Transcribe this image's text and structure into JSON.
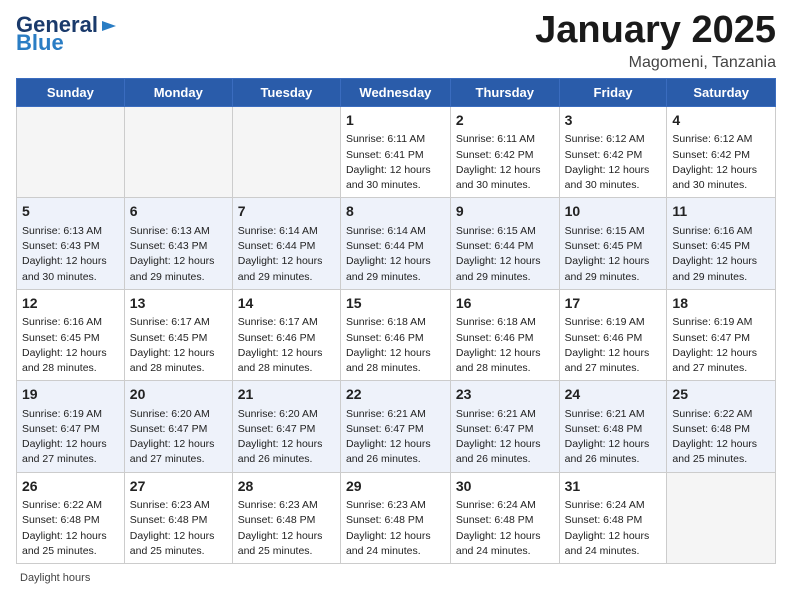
{
  "header": {
    "logo_line1": "General",
    "logo_line2": "Blue",
    "month_title": "January 2025",
    "subtitle": "Magomeni, Tanzania"
  },
  "days_of_week": [
    "Sunday",
    "Monday",
    "Tuesday",
    "Wednesday",
    "Thursday",
    "Friday",
    "Saturday"
  ],
  "weeks": [
    [
      {
        "day": "",
        "empty": true
      },
      {
        "day": "",
        "empty": true
      },
      {
        "day": "",
        "empty": true
      },
      {
        "day": "1",
        "sunrise": "6:11 AM",
        "sunset": "6:41 PM",
        "daylight": "12 hours and 30 minutes."
      },
      {
        "day": "2",
        "sunrise": "6:11 AM",
        "sunset": "6:42 PM",
        "daylight": "12 hours and 30 minutes."
      },
      {
        "day": "3",
        "sunrise": "6:12 AM",
        "sunset": "6:42 PM",
        "daylight": "12 hours and 30 minutes."
      },
      {
        "day": "4",
        "sunrise": "6:12 AM",
        "sunset": "6:42 PM",
        "daylight": "12 hours and 30 minutes."
      }
    ],
    [
      {
        "day": "5",
        "sunrise": "6:13 AM",
        "sunset": "6:43 PM",
        "daylight": "12 hours and 30 minutes."
      },
      {
        "day": "6",
        "sunrise": "6:13 AM",
        "sunset": "6:43 PM",
        "daylight": "12 hours and 29 minutes."
      },
      {
        "day": "7",
        "sunrise": "6:14 AM",
        "sunset": "6:44 PM",
        "daylight": "12 hours and 29 minutes."
      },
      {
        "day": "8",
        "sunrise": "6:14 AM",
        "sunset": "6:44 PM",
        "daylight": "12 hours and 29 minutes."
      },
      {
        "day": "9",
        "sunrise": "6:15 AM",
        "sunset": "6:44 PM",
        "daylight": "12 hours and 29 minutes."
      },
      {
        "day": "10",
        "sunrise": "6:15 AM",
        "sunset": "6:45 PM",
        "daylight": "12 hours and 29 minutes."
      },
      {
        "day": "11",
        "sunrise": "6:16 AM",
        "sunset": "6:45 PM",
        "daylight": "12 hours and 29 minutes."
      }
    ],
    [
      {
        "day": "12",
        "sunrise": "6:16 AM",
        "sunset": "6:45 PM",
        "daylight": "12 hours and 28 minutes."
      },
      {
        "day": "13",
        "sunrise": "6:17 AM",
        "sunset": "6:45 PM",
        "daylight": "12 hours and 28 minutes."
      },
      {
        "day": "14",
        "sunrise": "6:17 AM",
        "sunset": "6:46 PM",
        "daylight": "12 hours and 28 minutes."
      },
      {
        "day": "15",
        "sunrise": "6:18 AM",
        "sunset": "6:46 PM",
        "daylight": "12 hours and 28 minutes."
      },
      {
        "day": "16",
        "sunrise": "6:18 AM",
        "sunset": "6:46 PM",
        "daylight": "12 hours and 28 minutes."
      },
      {
        "day": "17",
        "sunrise": "6:19 AM",
        "sunset": "6:46 PM",
        "daylight": "12 hours and 27 minutes."
      },
      {
        "day": "18",
        "sunrise": "6:19 AM",
        "sunset": "6:47 PM",
        "daylight": "12 hours and 27 minutes."
      }
    ],
    [
      {
        "day": "19",
        "sunrise": "6:19 AM",
        "sunset": "6:47 PM",
        "daylight": "12 hours and 27 minutes."
      },
      {
        "day": "20",
        "sunrise": "6:20 AM",
        "sunset": "6:47 PM",
        "daylight": "12 hours and 27 minutes."
      },
      {
        "day": "21",
        "sunrise": "6:20 AM",
        "sunset": "6:47 PM",
        "daylight": "12 hours and 26 minutes."
      },
      {
        "day": "22",
        "sunrise": "6:21 AM",
        "sunset": "6:47 PM",
        "daylight": "12 hours and 26 minutes."
      },
      {
        "day": "23",
        "sunrise": "6:21 AM",
        "sunset": "6:47 PM",
        "daylight": "12 hours and 26 minutes."
      },
      {
        "day": "24",
        "sunrise": "6:21 AM",
        "sunset": "6:48 PM",
        "daylight": "12 hours and 26 minutes."
      },
      {
        "day": "25",
        "sunrise": "6:22 AM",
        "sunset": "6:48 PM",
        "daylight": "12 hours and 25 minutes."
      }
    ],
    [
      {
        "day": "26",
        "sunrise": "6:22 AM",
        "sunset": "6:48 PM",
        "daylight": "12 hours and 25 minutes."
      },
      {
        "day": "27",
        "sunrise": "6:23 AM",
        "sunset": "6:48 PM",
        "daylight": "12 hours and 25 minutes."
      },
      {
        "day": "28",
        "sunrise": "6:23 AM",
        "sunset": "6:48 PM",
        "daylight": "12 hours and 25 minutes."
      },
      {
        "day": "29",
        "sunrise": "6:23 AM",
        "sunset": "6:48 PM",
        "daylight": "12 hours and 24 minutes."
      },
      {
        "day": "30",
        "sunrise": "6:24 AM",
        "sunset": "6:48 PM",
        "daylight": "12 hours and 24 minutes."
      },
      {
        "day": "31",
        "sunrise": "6:24 AM",
        "sunset": "6:48 PM",
        "daylight": "12 hours and 24 minutes."
      },
      {
        "day": "",
        "empty": true
      }
    ]
  ],
  "footer": {
    "daylight_label": "Daylight hours"
  }
}
